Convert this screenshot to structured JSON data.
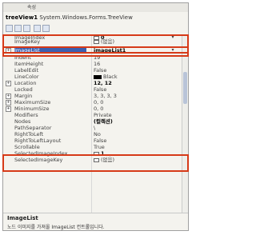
{
  "window": {
    "caption": "속성"
  },
  "object_selector": {
    "name": "treeView1",
    "type": "System.Windows.Forms.TreeView"
  },
  "toolbar": {
    "buttons": [
      "categorized-icon",
      "alphabetical-icon",
      "properties-icon",
      "events-icon",
      "property-pages-icon"
    ]
  },
  "properties": [
    {
      "name": "ImageIndex",
      "value": "0",
      "icon": true,
      "bold": true,
      "dd": true
    },
    {
      "name": "ImageKey",
      "value": "(없음)",
      "icon": true
    },
    {
      "name": "ImageList",
      "value": "imageList1",
      "bold": true,
      "selected": true,
      "dd": true,
      "expand": "+"
    },
    {
      "name": "Indent",
      "value": "19"
    },
    {
      "name": "ItemHeight",
      "value": "16"
    },
    {
      "name": "LabelEdit",
      "value": "False"
    },
    {
      "name": "LineColor",
      "value": "Black",
      "swatch": true
    },
    {
      "name": "Location",
      "value": "12, 12",
      "bold": true,
      "expand": "+"
    },
    {
      "name": "Locked",
      "value": "False"
    },
    {
      "name": "Margin",
      "value": "3, 3, 3, 3",
      "expand": "+"
    },
    {
      "name": "MaximumSize",
      "value": "0, 0",
      "expand": "+"
    },
    {
      "name": "MinimumSize",
      "value": "0, 0",
      "expand": "+"
    },
    {
      "name": "Modifiers",
      "value": "Private"
    },
    {
      "name": "Nodes",
      "value": "(컬렉션)",
      "bold": true
    },
    {
      "name": "PathSeparator",
      "value": "\\"
    },
    {
      "name": "RightToLeft",
      "value": "No"
    },
    {
      "name": "RightToLeftLayout",
      "value": "False"
    },
    {
      "name": "Scrollable",
      "value": "True"
    },
    {
      "name": "SelectedImageIndex",
      "value": "1",
      "icon": true,
      "bold": true
    },
    {
      "name": "SelectedImageKey",
      "value": "(없음)",
      "icon": true
    }
  ],
  "description": {
    "title": "ImageList",
    "text": "노드 이미지를 가져올 ImageList 컨트롤입니다."
  },
  "colors": {
    "highlight": "#d63a18",
    "selection": "#3a5fb0"
  }
}
